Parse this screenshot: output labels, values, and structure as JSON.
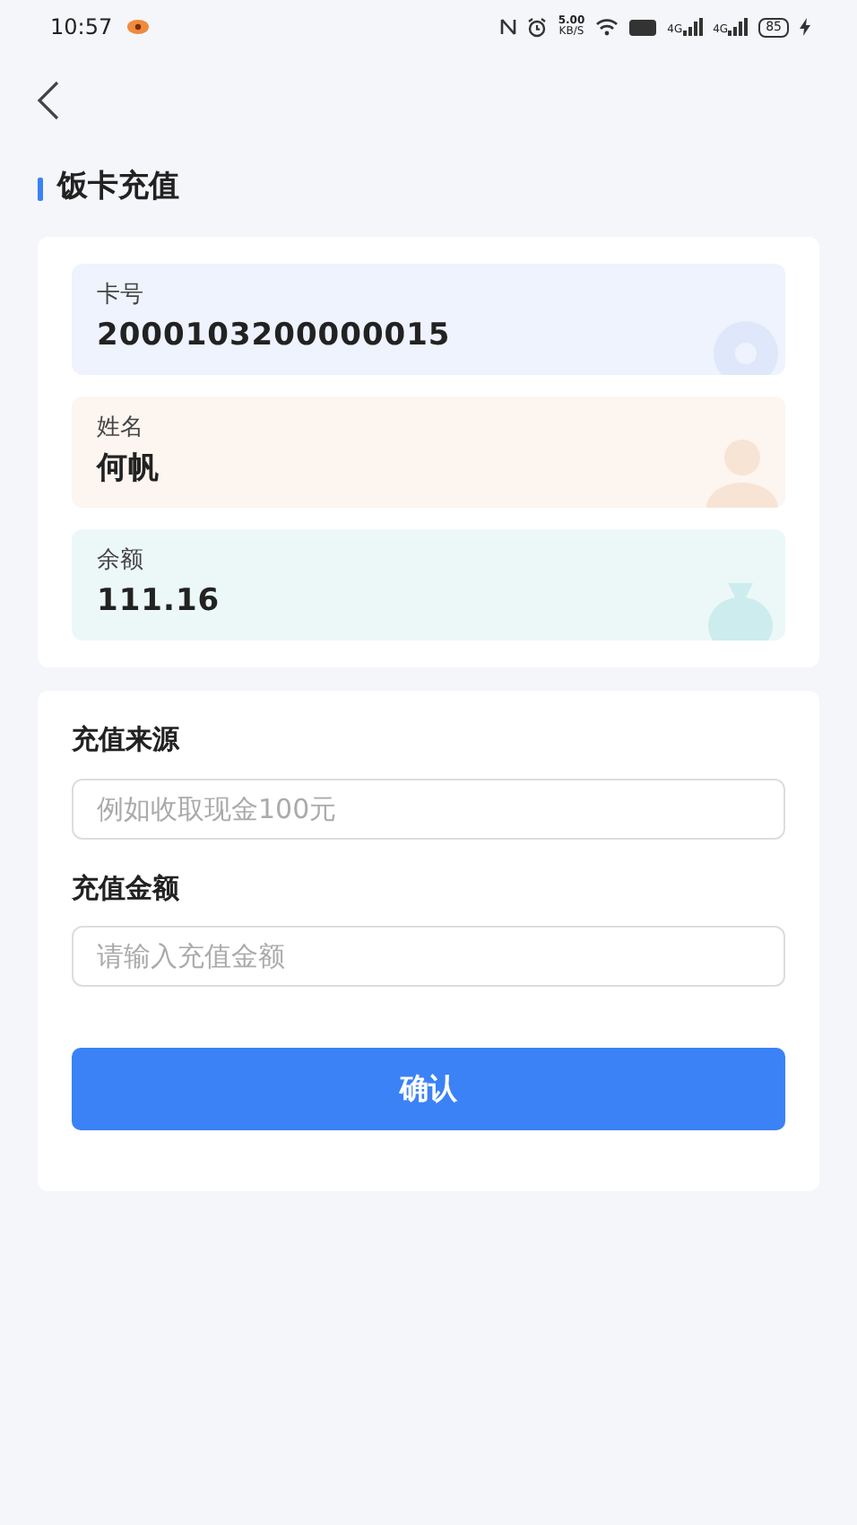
{
  "status_bar": {
    "time": "10:57",
    "speed": "5.00",
    "speed_unit": "KB/S",
    "network_labels": [
      "4G",
      "4G"
    ],
    "battery": "85"
  },
  "title": "饭卡充值",
  "info": [
    {
      "kind": "card",
      "label": "卡号",
      "value": "2000103200000015"
    },
    {
      "kind": "person",
      "label": "姓名",
      "value": "何帆"
    },
    {
      "kind": "money",
      "label": "余额",
      "value": "111.16"
    }
  ],
  "form": [
    {
      "label": "充值来源",
      "placeholder": "例如收取现金100元"
    },
    {
      "label": "充值金额",
      "placeholder": "请输入充值金额"
    }
  ],
  "submit": "确认"
}
